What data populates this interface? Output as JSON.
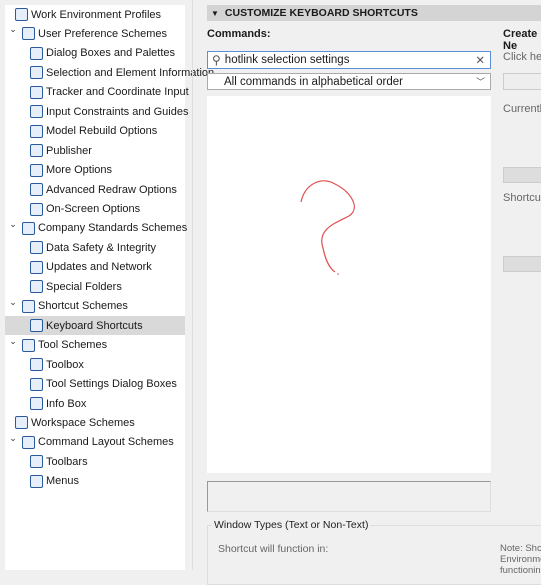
{
  "tree": [
    {
      "label": "Work Environment Profiles",
      "level": 0,
      "icon": "profiles-icon"
    },
    {
      "label": "User Preference Schemes",
      "level": 1,
      "icon": "scheme-icon",
      "expanded": true
    },
    {
      "label": "Dialog Boxes and Palettes",
      "level": 2,
      "icon": "dialog-icon"
    },
    {
      "label": "Selection and Element Information",
      "level": 2,
      "icon": "selection-icon"
    },
    {
      "label": "Tracker and Coordinate Input",
      "level": 2,
      "icon": "tracker-icon"
    },
    {
      "label": "Input Constraints and Guides",
      "level": 2,
      "icon": "mouse-icon"
    },
    {
      "label": "Model Rebuild Options",
      "level": 2,
      "icon": "rebuild-icon"
    },
    {
      "label": "Publisher",
      "level": 2,
      "icon": "publisher-icon"
    },
    {
      "label": "More Options",
      "level": 2,
      "icon": "sliders-icon"
    },
    {
      "label": "Advanced Redraw Options",
      "level": 2,
      "icon": "redraw-icon"
    },
    {
      "label": "On-Screen Options",
      "level": 2,
      "icon": "monitor-icon"
    },
    {
      "label": "Company Standards Schemes",
      "level": 1,
      "icon": "scheme-icon",
      "expanded": true
    },
    {
      "label": "Data Safety & Integrity",
      "level": 2,
      "icon": "safety-icon"
    },
    {
      "label": "Updates and Network",
      "level": 2,
      "icon": "globe-icon"
    },
    {
      "label": "Special Folders",
      "level": 2,
      "icon": "folder-icon"
    },
    {
      "label": "Shortcut Schemes",
      "level": 1,
      "icon": "scheme-icon",
      "expanded": true
    },
    {
      "label": "Keyboard Shortcuts",
      "level": 2,
      "icon": "shortcut-icon",
      "selected": true
    },
    {
      "label": "Tool Schemes",
      "level": 1,
      "icon": "scheme-icon",
      "expanded": true
    },
    {
      "label": "Toolbox",
      "level": 2,
      "icon": "toolbox-icon"
    },
    {
      "label": "Tool Settings Dialog Boxes",
      "level": 2,
      "icon": "dialog-icon"
    },
    {
      "label": "Info Box",
      "level": 2,
      "icon": "infobox-icon"
    },
    {
      "label": "Workspace Schemes",
      "level": 0,
      "icon": "scheme-icon"
    },
    {
      "label": "Command Layout Schemes",
      "level": 1,
      "icon": "scheme-icon",
      "expanded": true
    },
    {
      "label": "Toolbars",
      "level": 2,
      "icon": "toolbar-icon"
    },
    {
      "label": "Menus",
      "level": 2,
      "icon": "menu-icon"
    }
  ],
  "main": {
    "header": "CUSTOMIZE KEYBOARD SHORTCUTS",
    "commands_label": "Commands:",
    "search_value": "hotlink selection settings",
    "sort_selected": "All commands in alphabetical order",
    "group_title": "Window Types (Text or Non-Text)",
    "function_in": "Shortcut will function in:"
  },
  "right": {
    "create_label": "Create Ne",
    "click_here": "Click here",
    "currently": "Currently",
    "shortcuts": "Shortcut(s",
    "note1": "Note: Shor",
    "note2": "Environmen",
    "note3": "functioning"
  },
  "annotation_color": "#e05050"
}
